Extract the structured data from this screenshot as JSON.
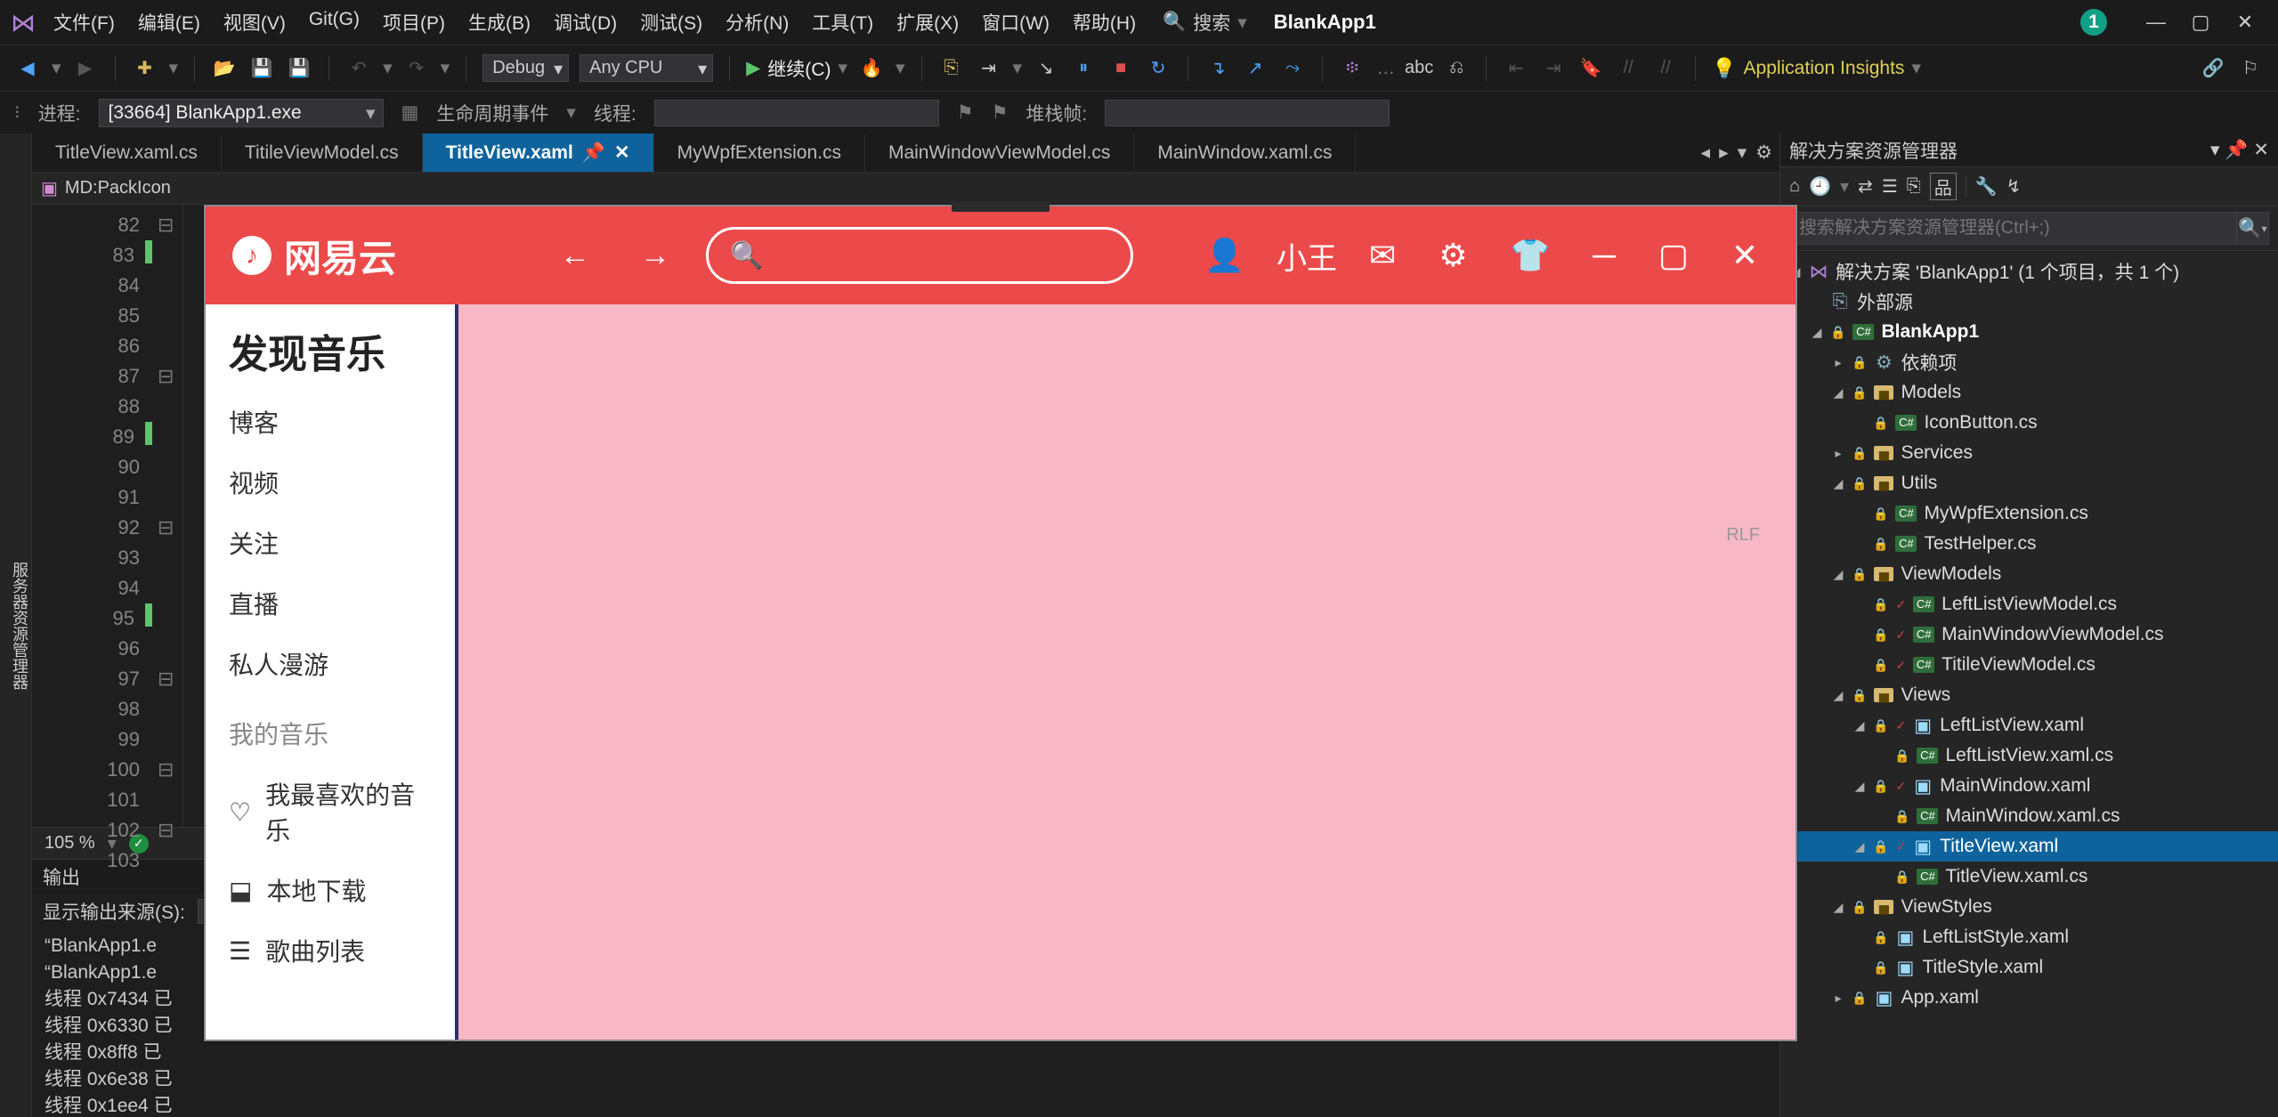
{
  "titlebar": {
    "menus": [
      "文件(F)",
      "编辑(E)",
      "视图(V)",
      "Git(G)",
      "项目(P)",
      "生成(B)",
      "调试(D)",
      "测试(S)",
      "分析(N)",
      "工具(T)",
      "扩展(X)",
      "窗口(W)",
      "帮助(H)"
    ],
    "search_label": "搜索",
    "project": "BlankApp1",
    "badge": "1"
  },
  "toolbar": {
    "config": "Debug",
    "platform": "Any CPU",
    "run_label": "继续(C)",
    "ai_label": "Application Insights"
  },
  "toolbar2": {
    "process_label": "进程:",
    "process_value": "[33664] BlankApp1.exe",
    "lifecycle": "生命周期事件",
    "thread": "线程:",
    "stackframe": "堆栈帧:"
  },
  "leftrail": "服务器资源管理器",
  "tabs": [
    "TitleView.xaml.cs",
    "TitileViewModel.cs",
    "TitleView.xaml",
    "MyWpfExtension.cs",
    "MainWindowViewModel.cs",
    "MainWindow.xaml.cs"
  ],
  "active_tab_index": 2,
  "crumb": "MD:PackIcon",
  "gutter_lines": [
    "82",
    "83",
    "84",
    "85",
    "86",
    "87",
    "88",
    "89",
    "90",
    "91",
    "92",
    "93",
    "94",
    "95",
    "96",
    "97",
    "98",
    "99",
    "100",
    "101",
    "102",
    "103"
  ],
  "zoom": "105 %",
  "lineinfo": "RLF",
  "preview": {
    "brand": "网易云",
    "user": "小王",
    "side_heading": "发现音乐",
    "side_items1": [
      "博客",
      "视频",
      "关注",
      "直播",
      "私人漫游"
    ],
    "side_group": "我的音乐",
    "side_items2": [
      "我最喜欢的音乐",
      "本地下载",
      "歌曲列表"
    ]
  },
  "output": {
    "title": "输出",
    "source_label": "显示输出来源(S):",
    "lines": [
      "“BlankApp1.e",
      "“BlankApp1.e",
      "线程 0x7434 已",
      "线程 0x6330 已",
      "线程 0x8ff8 已",
      "线程 0x6e38 已",
      "线程 0x1ee4 已"
    ]
  },
  "soln": {
    "title": "解决方案资源管理器",
    "search_placeholder": "搜索解决方案资源管理器(Ctrl+;)",
    "root": "解决方案 'BlankApp1' (1 个项目，共 1 个)",
    "ext_src": "外部源",
    "project": "BlankApp1",
    "deps": "依赖项",
    "folders": {
      "Models": [
        "IconButton.cs"
      ],
      "Services": [],
      "Utils": [
        "MyWpfExtension.cs",
        "TestHelper.cs"
      ],
      "ViewModels": [
        "LeftListViewModel.cs",
        "MainWindowViewModel.cs",
        "TitileViewModel.cs"
      ],
      "Views": {
        "LeftListView.xaml": [
          "LeftListView.xaml.cs"
        ],
        "MainWindow.xaml": [
          "MainWindow.xaml.cs"
        ],
        "TitleView.xaml": [
          "TitleView.xaml.cs"
        ]
      },
      "ViewStyles": [
        "LeftListStyle.xaml",
        "TitleStyle.xaml"
      ]
    },
    "appxaml": "App.xaml"
  }
}
